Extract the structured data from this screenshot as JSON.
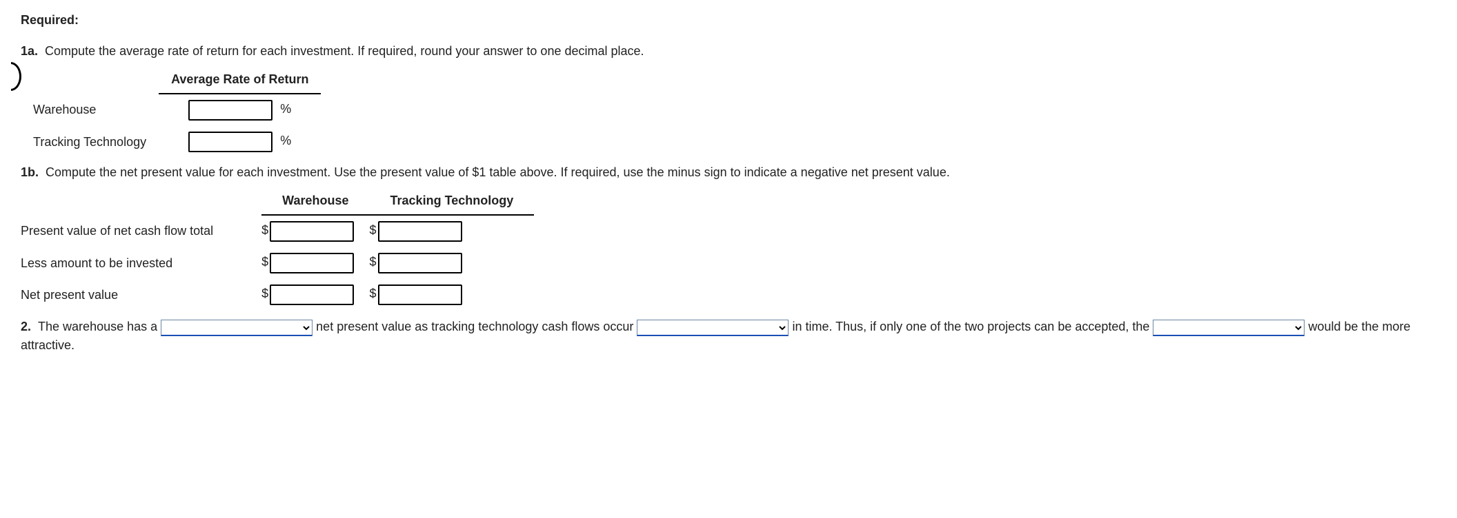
{
  "required_label": "Required:",
  "q1a": {
    "number": "1a.",
    "text": "Compute the average rate of return for each investment. If required, round your answer to one decimal place."
  },
  "table1": {
    "header": "Average Rate of Return",
    "rows": [
      {
        "label": "Warehouse",
        "suffix": "%"
      },
      {
        "label": "Tracking Technology",
        "suffix": "%"
      }
    ]
  },
  "q1b": {
    "number": "1b.",
    "text": "Compute the net present value for each investment. Use the present value of $1 table above. If required, use the minus sign to indicate a negative net present value."
  },
  "table2": {
    "col1": "Warehouse",
    "col2": "Tracking Technology",
    "rows": [
      {
        "label": "Present value of net cash flow total",
        "prefix": "$"
      },
      {
        "label": "Less amount to be invested",
        "prefix": "$"
      },
      {
        "label": "Net present value",
        "prefix": "$"
      }
    ]
  },
  "q2": {
    "number": "2.",
    "part1": "The warehouse has a",
    "part2": "net present value as tracking technology cash flows occur",
    "part3": "in time. Thus, if only one of the two projects can be accepted, the",
    "part4": "would be the more attractive."
  }
}
